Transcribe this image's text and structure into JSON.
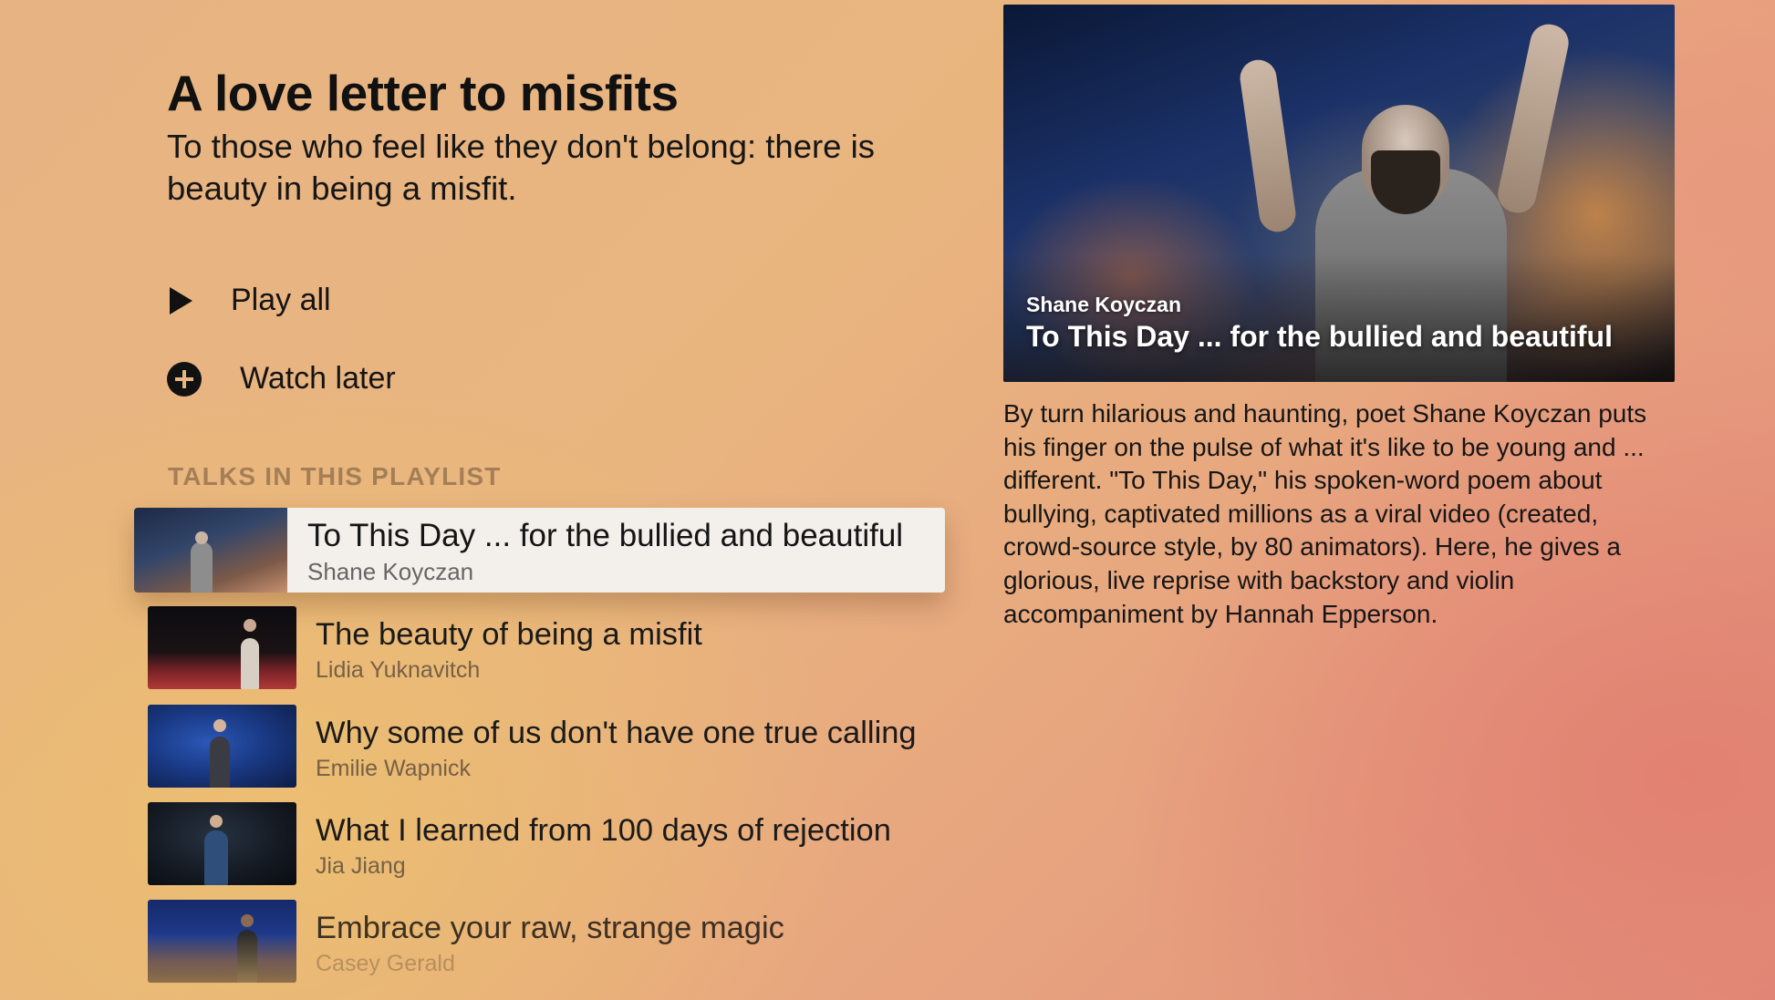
{
  "playlist": {
    "title": "A love letter to misfits",
    "subtitle": "To those who feel like they don't belong: there is beauty in being a misfit."
  },
  "actions": {
    "play_all": {
      "label": "Play all",
      "icon": "play-icon"
    },
    "watch_later": {
      "label": "Watch later",
      "icon": "plus-circle-icon"
    }
  },
  "talks_section": {
    "header": "TALKS IN THIS PLAYLIST",
    "items": [
      {
        "title": "To This Day ... for the bullied and beautiful",
        "speaker": "Shane Koyczan",
        "focused": true
      },
      {
        "title": "The beauty of being a misfit",
        "speaker": "Lidia Yuknavitch",
        "focused": false
      },
      {
        "title": "Why some of us don't have one true calling",
        "speaker": "Emilie Wapnick",
        "focused": false
      },
      {
        "title": "What I learned from 100 days of rejection",
        "speaker": "Jia Jiang",
        "focused": false
      },
      {
        "title": "Embrace your raw, strange magic",
        "speaker": "Casey Gerald",
        "focused": false
      }
    ]
  },
  "preview": {
    "speaker": "Shane Koyczan",
    "title": "To This Day ... for the bullied and beautiful",
    "description": "By turn hilarious and haunting, poet Shane Koyczan puts his finger on the pulse of what it's like to be young and ... different. \"To This Day,\" his spoken-word poem about bullying, captivated millions as a viral video (created, crowd-source style, by 80 animators). Here, he gives a glorious, live reprise with backstory and violin accompaniment by Hannah Epperson."
  },
  "colors": {
    "background_warm": "#e9b57f",
    "background_coral": "#e08c79",
    "focus_card": "#f3efea"
  }
}
